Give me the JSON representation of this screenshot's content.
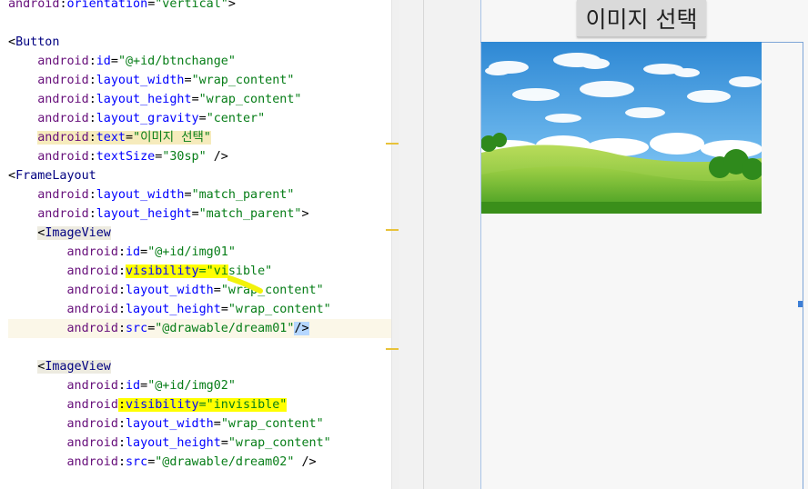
{
  "editor": {
    "lines": [
      {
        "seg": [
          [
            "ns",
            "android"
          ],
          [
            "punct",
            ":"
          ],
          [
            "at",
            "orientation"
          ],
          [
            "punct",
            "="
          ],
          [
            "str",
            "\"vertical\""
          ],
          [
            "punct",
            ">"
          ]
        ]
      },
      {
        "seg": []
      },
      {
        "seg": [
          [
            "punct",
            "<"
          ],
          [
            "tag",
            "Button"
          ]
        ]
      },
      {
        "seg": [
          [
            "ns",
            "    android"
          ],
          [
            "punct",
            ":"
          ],
          [
            "at",
            "id"
          ],
          [
            "punct",
            "="
          ],
          [
            "str",
            "\"@+id/btnchange\""
          ]
        ]
      },
      {
        "seg": [
          [
            "ns",
            "    android"
          ],
          [
            "punct",
            ":"
          ],
          [
            "at",
            "layout_width"
          ],
          [
            "punct",
            "="
          ],
          [
            "str",
            "\"wrap_content\""
          ]
        ]
      },
      {
        "seg": [
          [
            "ns",
            "    android"
          ],
          [
            "punct",
            ":"
          ],
          [
            "at",
            "layout_height"
          ],
          [
            "punct",
            "="
          ],
          [
            "str",
            "\"wrap_content\""
          ]
        ]
      },
      {
        "seg": [
          [
            "ns",
            "    android"
          ],
          [
            "punct",
            ":"
          ],
          [
            "at",
            "layout_gravity"
          ],
          [
            "punct",
            "="
          ],
          [
            "str",
            "\"center\""
          ]
        ]
      },
      {
        "seg": [
          [
            "punct",
            "    "
          ],
          [
            "tanns",
            "android"
          ],
          [
            "tanp",
            ":"
          ],
          [
            "tanat",
            "text"
          ],
          [
            "tanp",
            "="
          ],
          [
            "tanstr",
            "\"이미지 선택\""
          ]
        ]
      },
      {
        "seg": [
          [
            "ns",
            "    android"
          ],
          [
            "punct",
            ":"
          ],
          [
            "at",
            "textSize"
          ],
          [
            "punct",
            "="
          ],
          [
            "str",
            "\"30sp\""
          ],
          [
            "punct",
            " />"
          ]
        ]
      },
      {
        "seg": [
          [
            "punct",
            "<"
          ],
          [
            "tag",
            "FrameLayout"
          ]
        ]
      },
      {
        "seg": [
          [
            "ns",
            "    android"
          ],
          [
            "punct",
            ":"
          ],
          [
            "at",
            "layout_width"
          ],
          [
            "punct",
            "="
          ],
          [
            "str",
            "\"match_parent\""
          ]
        ]
      },
      {
        "seg": [
          [
            "ns",
            "    android"
          ],
          [
            "punct",
            ":"
          ],
          [
            "at",
            "layout_height"
          ],
          [
            "punct",
            "="
          ],
          [
            "str",
            "\"match_parent\""
          ],
          [
            "punct",
            ">"
          ]
        ]
      },
      {
        "seg": [
          [
            "punct",
            "    "
          ],
          [
            "hltagp",
            "<"
          ],
          [
            "hltag",
            "ImageView"
          ]
        ]
      },
      {
        "seg": [
          [
            "ns",
            "        android"
          ],
          [
            "punct",
            ":"
          ],
          [
            "at",
            "id"
          ],
          [
            "punct",
            "="
          ],
          [
            "str",
            "\"@+id/img01\""
          ]
        ]
      },
      {
        "seg": [
          [
            "ns",
            "        android"
          ],
          [
            "punct",
            ":"
          ],
          [
            "yat",
            "visibility"
          ],
          [
            "ystr",
            "=\"vi"
          ],
          [
            "str",
            "sible\""
          ]
        ]
      },
      {
        "seg": [
          [
            "ns",
            "        android"
          ],
          [
            "punct",
            ":"
          ],
          [
            "at",
            "layout_width"
          ],
          [
            "punct",
            "="
          ],
          [
            "str",
            "\"wrap_content\""
          ]
        ]
      },
      {
        "seg": [
          [
            "ns",
            "        android"
          ],
          [
            "punct",
            ":"
          ],
          [
            "at",
            "layout_height"
          ],
          [
            "punct",
            "="
          ],
          [
            "str",
            "\"wrap_content\""
          ]
        ]
      },
      {
        "seg": [
          [
            "ns",
            "        android"
          ],
          [
            "punct",
            ":"
          ],
          [
            "at",
            "src"
          ],
          [
            "punct",
            "="
          ],
          [
            "str",
            "\"@drawable/dream01\""
          ],
          [
            "sel",
            "/>"
          ]
        ],
        "current": true
      },
      {
        "seg": []
      },
      {
        "seg": [
          [
            "punct",
            "    "
          ],
          [
            "hltagp",
            "<"
          ],
          [
            "hltag",
            "ImageView"
          ]
        ]
      },
      {
        "seg": [
          [
            "ns",
            "        android"
          ],
          [
            "punct",
            ":"
          ],
          [
            "at",
            "id"
          ],
          [
            "punct",
            "="
          ],
          [
            "str",
            "\"@+id/img02\""
          ]
        ]
      },
      {
        "seg": [
          [
            "ns",
            "        android"
          ],
          [
            "ypunct",
            ":"
          ],
          [
            "yat",
            "visibility"
          ],
          [
            "ystr",
            "=\"invisible\""
          ]
        ]
      },
      {
        "seg": [
          [
            "ns",
            "        android"
          ],
          [
            "punct",
            ":"
          ],
          [
            "at",
            "layout_width"
          ],
          [
            "punct",
            "="
          ],
          [
            "str",
            "\"wrap_content\""
          ]
        ]
      },
      {
        "seg": [
          [
            "ns",
            "        android"
          ],
          [
            "punct",
            ":"
          ],
          [
            "at",
            "layout_height"
          ],
          [
            "punct",
            "="
          ],
          [
            "str",
            "\"wrap_content\""
          ]
        ]
      },
      {
        "seg": [
          [
            "ns",
            "        android"
          ],
          [
            "punct",
            ":"
          ],
          [
            "at",
            "src"
          ],
          [
            "punct",
            "="
          ],
          [
            "str",
            "\"@drawable/dream02\""
          ],
          [
            "punct",
            " />"
          ]
        ]
      }
    ]
  },
  "preview": {
    "button_text": "이미지 선택",
    "image": "dream01-landscape"
  },
  "colors": {
    "namespace": "#660e7a",
    "attribute": "#0000ff",
    "string": "#067d17",
    "tag": "#000080",
    "highlight": "#ffff00",
    "preview_bg": "#f7f7f7",
    "selection_border": "#7ea5d8"
  }
}
